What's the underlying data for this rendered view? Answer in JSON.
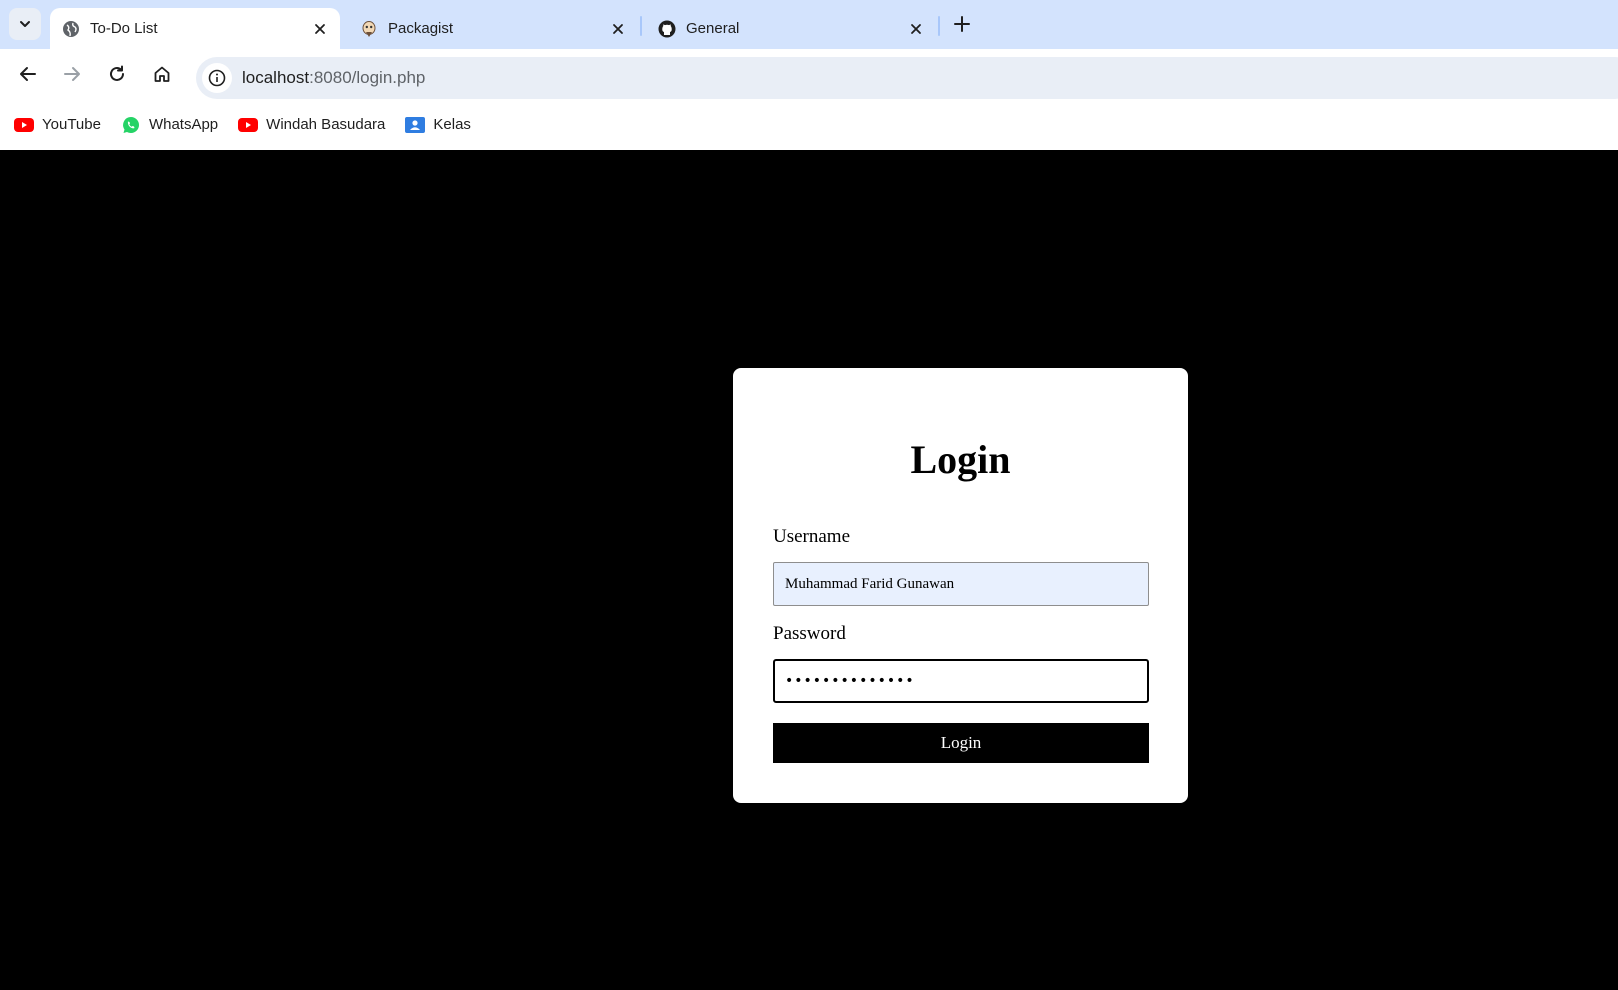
{
  "browser": {
    "tabs": [
      {
        "title": "To-Do List",
        "icon": "globe-icon",
        "active": true
      },
      {
        "title": "Packagist",
        "icon": "packagist-icon",
        "active": false
      },
      {
        "title": "General",
        "icon": "github-icon",
        "active": false
      }
    ],
    "url_host": "localhost",
    "url_rest": ":8080/login.php",
    "bookmarks": [
      {
        "label": "YouTube",
        "icon": "youtube-icon"
      },
      {
        "label": "WhatsApp",
        "icon": "whatsapp-icon"
      },
      {
        "label": "Windah Basudara",
        "icon": "youtube-icon"
      },
      {
        "label": "Kelas",
        "icon": "google-classroom-icon"
      }
    ]
  },
  "login": {
    "heading": "Login",
    "username_label": "Username",
    "username_value": "Muhammad Farid Gunawan",
    "password_label": "Password",
    "password_mask": "••••••••••••••",
    "submit_label": "Login"
  },
  "colors": {
    "tabstrip": "#d3e3fd",
    "omnibox": "#e9eef6",
    "page_background": "#000000",
    "card_background": "#ffffff",
    "autofill": "#e8f0fe",
    "button": "#000000"
  }
}
